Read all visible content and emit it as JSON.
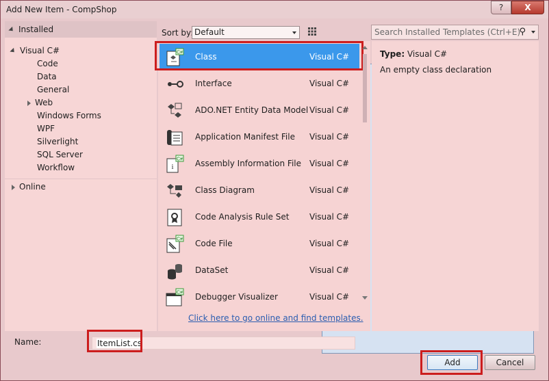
{
  "window": {
    "title": "Add New Item - CompShop",
    "help_label": "?",
    "close_label": "X"
  },
  "tree": {
    "installed": "Installed",
    "visual_csharp": "Visual C#",
    "children": [
      "Code",
      "Data",
      "General",
      "Web",
      "Windows Forms",
      "WPF",
      "Silverlight",
      "SQL Server",
      "Workflow"
    ],
    "online": "Online"
  },
  "sort": {
    "label": "Sort by:",
    "value": "Default"
  },
  "search": {
    "placeholder": "Search Installed Templates (Ctrl+E)"
  },
  "templates": [
    {
      "name": "Class",
      "lang": "Visual C#",
      "icon": "class-icon"
    },
    {
      "name": "Interface",
      "lang": "Visual C#",
      "icon": "interface-icon"
    },
    {
      "name": "ADO.NET Entity Data Model",
      "lang": "Visual C#",
      "icon": "entity-model-icon"
    },
    {
      "name": "Application Manifest File",
      "lang": "Visual C#",
      "icon": "manifest-icon"
    },
    {
      "name": "Assembly Information File",
      "lang": "Visual C#",
      "icon": "assembly-info-icon"
    },
    {
      "name": "Class Diagram",
      "lang": "Visual C#",
      "icon": "class-diagram-icon"
    },
    {
      "name": "Code Analysis Rule Set",
      "lang": "Visual C#",
      "icon": "rule-set-icon"
    },
    {
      "name": "Code File",
      "lang": "Visual C#",
      "icon": "code-file-icon"
    },
    {
      "name": "DataSet",
      "lang": "Visual C#",
      "icon": "dataset-icon"
    },
    {
      "name": "Debugger Visualizer",
      "lang": "Visual C#",
      "icon": "debugger-visualizer-icon"
    }
  ],
  "online_link": "Click here to go online and find templates.",
  "detail": {
    "type_label": "Type:",
    "type_value": "Visual C#",
    "description": "An empty class declaration"
  },
  "name_field": {
    "label": "Name:",
    "value": "ItemList.cs"
  },
  "buttons": {
    "add": "Add",
    "cancel": "Cancel"
  }
}
